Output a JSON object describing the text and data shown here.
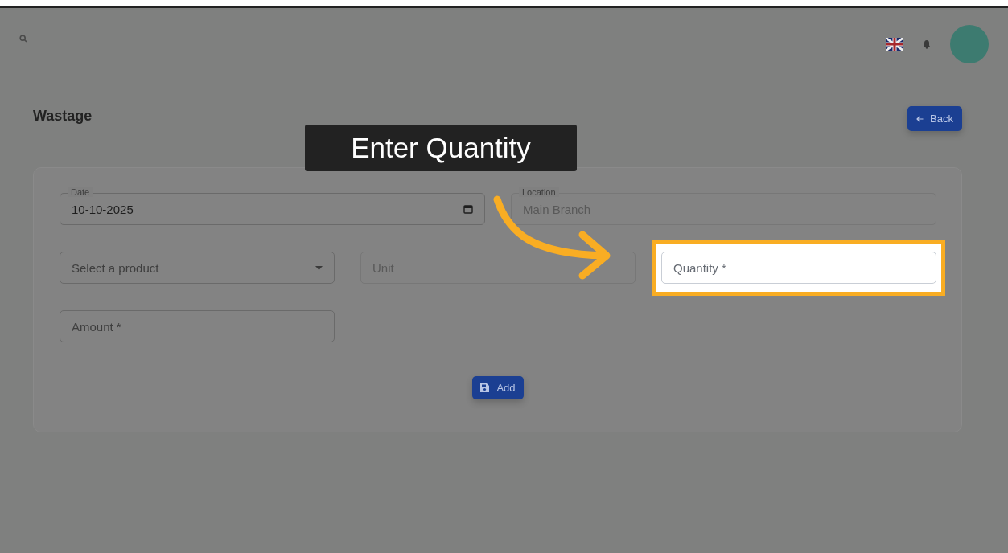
{
  "page": {
    "title": "Wastage",
    "back_button": "Back"
  },
  "form": {
    "fields": [
      {
        "kind": "date",
        "label": "Date",
        "value": "10-10-2025",
        "highlighted": false
      },
      {
        "kind": "readonly",
        "label": "Location",
        "value": "Main Branch",
        "highlighted": false
      },
      {
        "kind": "select",
        "placeholder": "Select a product",
        "highlighted": false
      },
      {
        "kind": "readonly",
        "placeholder": "Unit",
        "highlighted": false
      },
      {
        "kind": "input",
        "placeholder": "Quantity *",
        "highlighted": true
      },
      {
        "kind": "input",
        "placeholder": "Amount *",
        "highlighted": false
      }
    ],
    "submit": "Add"
  },
  "callout": {
    "text": "Enter Quantity"
  }
}
